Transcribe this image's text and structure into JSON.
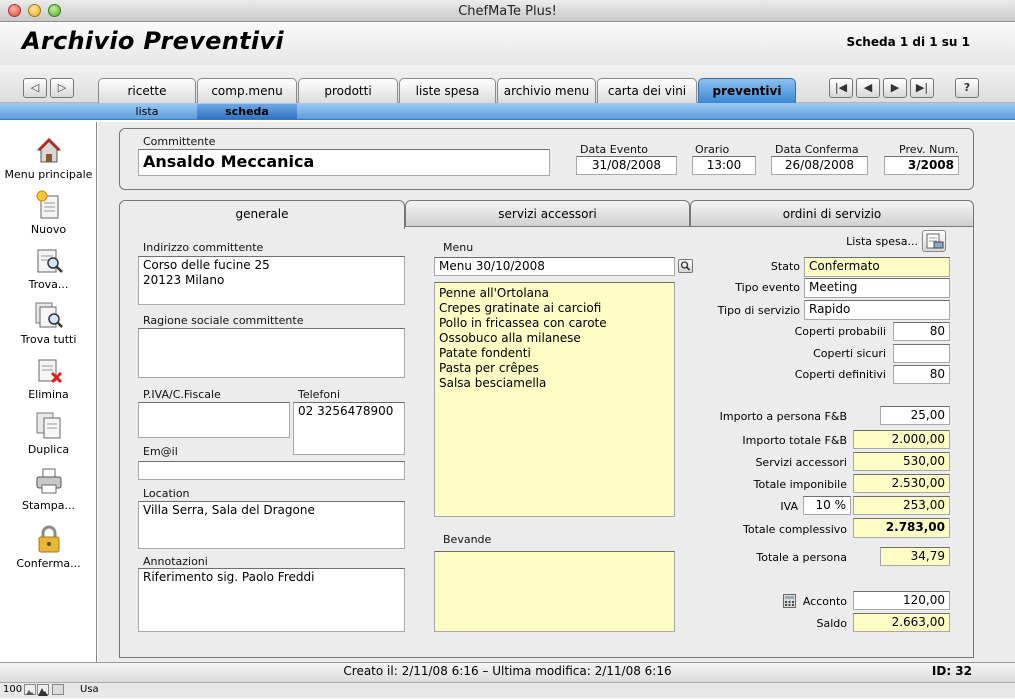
{
  "window": {
    "title": "ChefMaTe Plus!"
  },
  "header": {
    "title": "Archivio Preventivi",
    "record_info": "Scheda 1 di 1 su 1"
  },
  "main_tabs": [
    "ricette",
    "comp.menu",
    "prodotti",
    "liste spesa",
    "archivio menu",
    "carta dei vini",
    "preventivi"
  ],
  "sub_tabs": [
    "lista",
    "scheda"
  ],
  "help_label": "?",
  "sidebar": {
    "items": [
      "Menu principale",
      "Nuovo",
      "Trova...",
      "Trova tutti",
      "Elimina",
      "Duplica",
      "Stampa...",
      "Conferma..."
    ]
  },
  "top": {
    "committente_label": "Committente",
    "committente": "Ansaldo Meccanica",
    "data_evento_label": "Data Evento",
    "data_evento": "31/08/2008",
    "orario_label": "Orario",
    "orario": "13:00",
    "data_conferma_label": "Data Conferma",
    "data_conferma": "26/08/2008",
    "prev_num_label": "Prev. Num.",
    "prev_num": "3/2008"
  },
  "form_tabs": [
    "generale",
    "servizi accessori",
    "ordini di servizio"
  ],
  "left": {
    "indirizzo_label": "Indirizzo committente",
    "indirizzo_1": "Corso delle fucine 25",
    "indirizzo_2": "20123 Milano",
    "ragione_label": "Ragione sociale committente",
    "ragione": "",
    "piva_label": "P.IVA/C.Fiscale",
    "piva": "",
    "telefoni_label": "Telefoni",
    "telefono": "02 3256478900",
    "email_label": "Em@il",
    "email": "",
    "location_label": "Location",
    "location": "Villa Serra, Sala del Dragone",
    "annotazioni_label": "Annotazioni",
    "annotazioni": "Riferimento sig. Paolo Freddi"
  },
  "menu": {
    "label": "Menu",
    "name": "Menu 30/10/2008",
    "items": [
      "Penne all'Ortolana",
      "Crepes gratinate ai carciofi",
      "Pollo in fricassea con carote",
      "Ossobuco alla milanese",
      "Patate fondenti",
      "Pasta per crêpes",
      "Salsa besciamella"
    ],
    "bevande_label": "Bevande"
  },
  "right": {
    "lista_spesa": "Lista spesa...",
    "stato_label": "Stato",
    "stato": "Confermato",
    "tipo_evento_label": "Tipo evento",
    "tipo_evento": "Meeting",
    "tipo_servizio_label": "Tipo di servizio",
    "tipo_servizio": "Rapido",
    "coperti_probabili_label": "Coperti probabili",
    "coperti_probabili": "80",
    "coperti_sicuri_label": "Coperti sicuri",
    "coperti_sicuri": "",
    "coperti_definitivi_label": "Coperti definitivi",
    "coperti_definitivi": "80",
    "importo_persona_label": "Importo a persona F&B",
    "importo_persona": "25,00",
    "importo_totale_label": "Importo totale F&B",
    "importo_totale": "2.000,00",
    "servizi_label": "Servizi accessori",
    "servizi": "530,00",
    "imponibile_label": "Totale imponibile",
    "imponibile": "2.530,00",
    "iva_label": "IVA",
    "iva_pct": "10 %",
    "iva": "253,00",
    "complessivo_label": "Totale complessivo",
    "complessivo": "2.783,00",
    "totale_persona_label": "Totale a persona",
    "totale_persona": "34,79",
    "acconto_label": "Acconto",
    "acconto": "120,00",
    "saldo_label": "Saldo",
    "saldo": "2.663,00"
  },
  "status": {
    "created": "Creato il: 2/11/08 6:16 – Ultima modifica: 2/11/08 6:16",
    "id": "ID: 32"
  },
  "bottom": {
    "zoom": "100",
    "mode": "Usa"
  }
}
